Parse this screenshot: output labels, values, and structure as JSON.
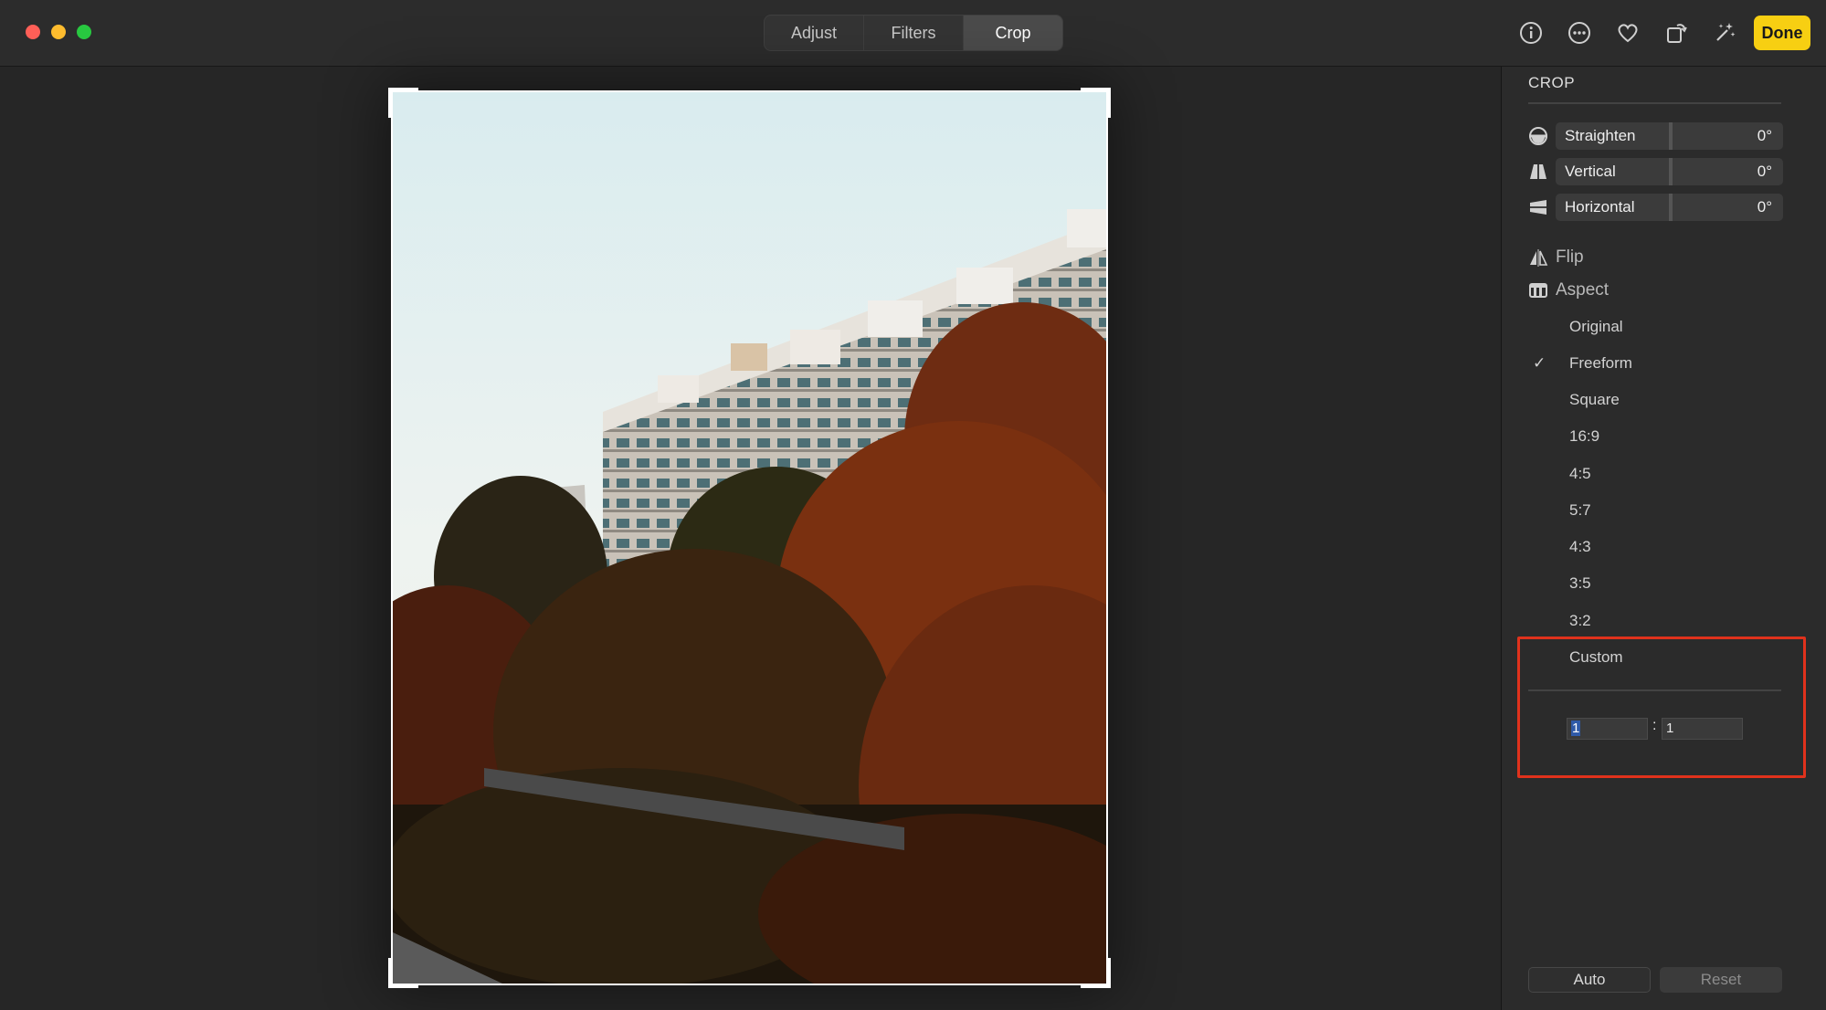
{
  "toolbar": {
    "tabs": [
      {
        "label": "Adjust",
        "active": false
      },
      {
        "label": "Filters",
        "active": false
      },
      {
        "label": "Crop",
        "active": true
      }
    ],
    "done_label": "Done",
    "icons": [
      "info-icon",
      "more-icon",
      "heart-icon",
      "rotate-icon",
      "magic-wand-icon"
    ]
  },
  "panel": {
    "title": "CROP",
    "sliders": [
      {
        "label": "Straighten",
        "value": "0°",
        "icon": "straighten-icon"
      },
      {
        "label": "Vertical",
        "value": "0°",
        "icon": "vertical-icon"
      },
      {
        "label": "Horizontal",
        "value": "0°",
        "icon": "horizontal-icon"
      }
    ],
    "flip_label": "Flip",
    "aspect_label": "Aspect",
    "aspect_options": [
      "Original",
      "Freeform",
      "Square",
      "16:9",
      "4:5",
      "5:7",
      "4:3",
      "3:5",
      "3:2",
      "Custom"
    ],
    "selected_aspect": "Freeform",
    "check_glyph": "✓",
    "custom_ratio": {
      "width": "1",
      "height": "1",
      "separator": ":"
    },
    "auto_label": "Auto",
    "reset_label": "Reset"
  },
  "colors": {
    "accent_done": "#f7cf12",
    "highlight": "#e0321c"
  }
}
